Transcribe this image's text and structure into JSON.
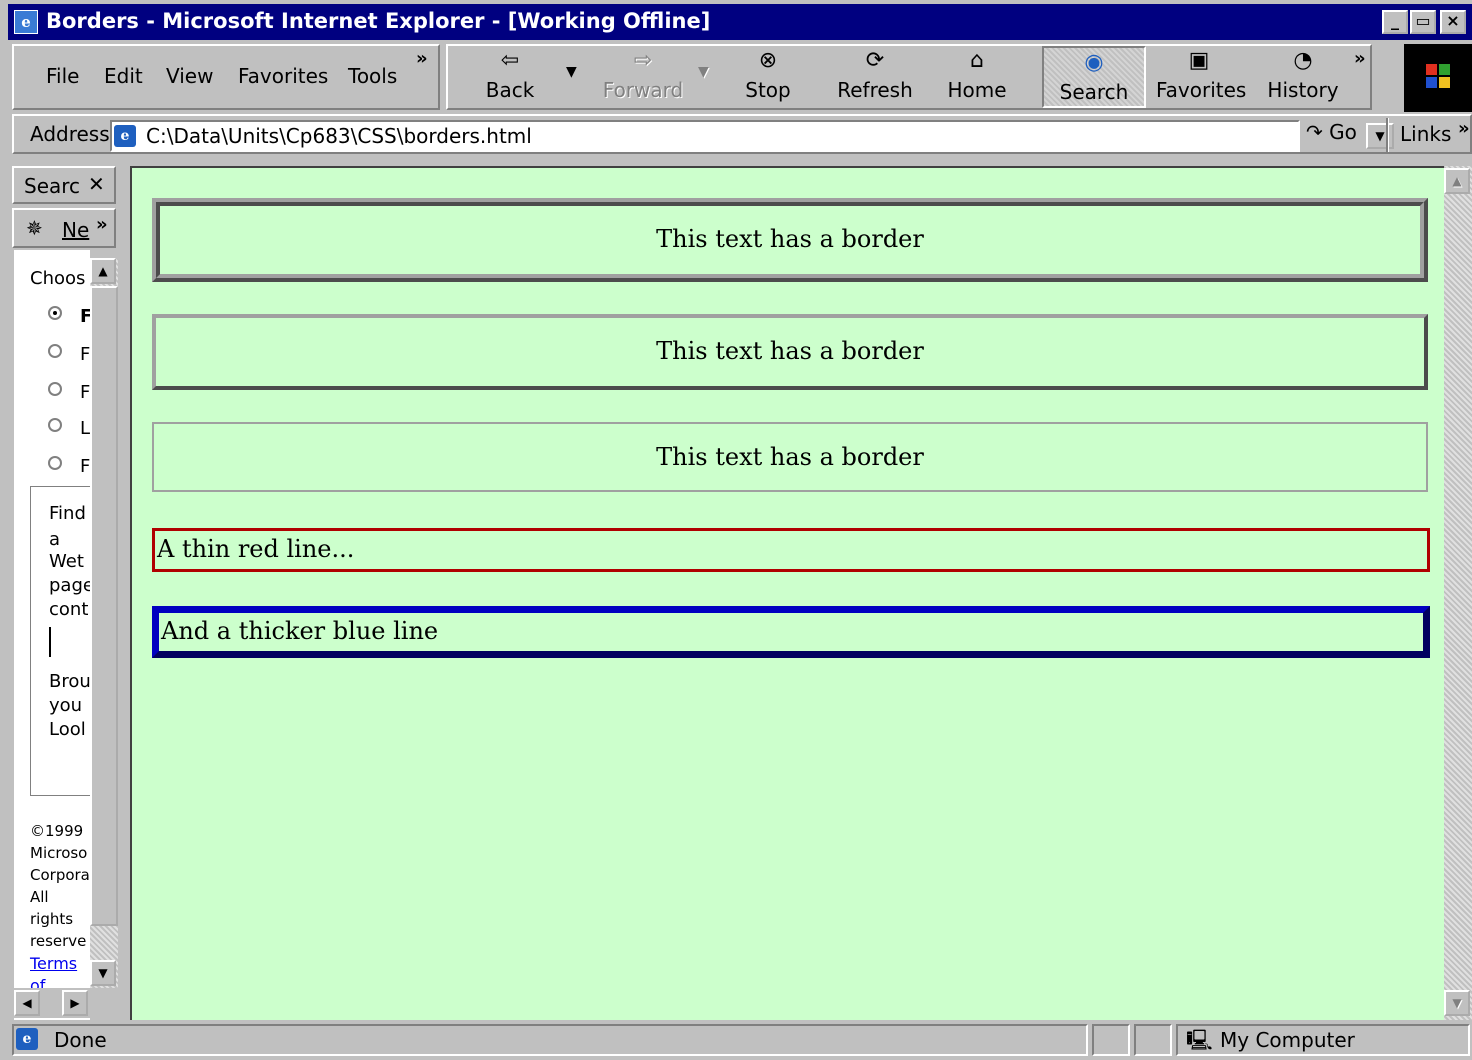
{
  "window": {
    "title": "Borders - Microsoft Internet Explorer - [Working Offline]",
    "controls": [
      "_",
      "▭",
      "×"
    ]
  },
  "menu": {
    "items": [
      "File",
      "Edit",
      "View",
      "Favorites",
      "Tools"
    ],
    "overflow": "»"
  },
  "toolbar": {
    "back": "Back",
    "forward": "Forward",
    "stop": "Stop",
    "refresh": "Refresh",
    "home": "Home",
    "search": "Search",
    "favorites": "Favorites",
    "history": "History",
    "overflow": "»"
  },
  "address": {
    "label": "Address",
    "url": "C:\\Data\\Units\\Cp683\\CSS\\borders.html",
    "go": "Go",
    "links": "Links",
    "links_overflow": "»"
  },
  "explorer": {
    "title": "Searc",
    "new": "Ne",
    "new_overflow": "»",
    "choose": "Choos",
    "options": [
      "F",
      "F",
      "F",
      "L",
      "F"
    ],
    "find_lines": [
      "Find",
      "a",
      "Wet",
      "page",
      "cont"
    ],
    "browse_lines": [
      "Brou",
      "you",
      "Lool"
    ],
    "copyright_lines": [
      "©1999",
      "Microso",
      "Corpora",
      "All",
      "rights",
      "reserve"
    ],
    "terms_lines": [
      "Terms",
      "of"
    ]
  },
  "page": {
    "box1": "This text has a border",
    "box2": "This text has a border",
    "box3": "This text has a border",
    "box4": "A thin red line...",
    "box5": "And a thicker blue line",
    "background": "#ccffcc",
    "red_line_color": "#b00000",
    "blue_line_color": "#0000c0"
  },
  "status": {
    "text": "Done",
    "zone": "My Computer"
  }
}
